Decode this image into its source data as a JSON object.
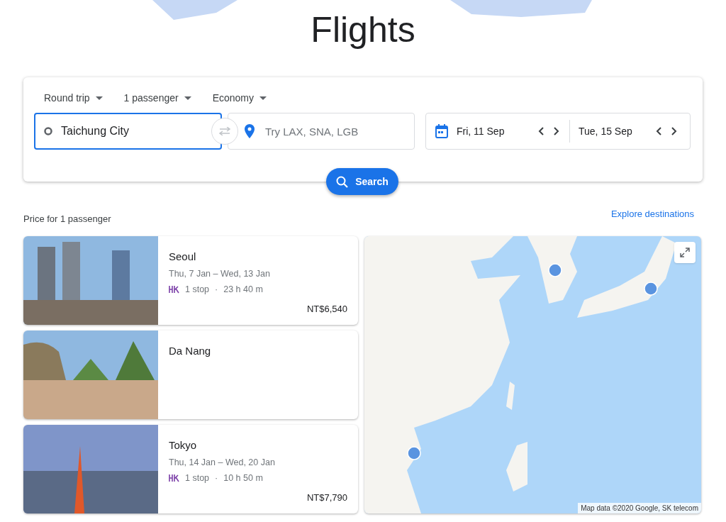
{
  "title": "Flights",
  "search": {
    "options": [
      {
        "label": "Round trip"
      },
      {
        "label": "1 passenger"
      },
      {
        "label": "Economy"
      }
    ],
    "origin": {
      "value": "Taichung City",
      "focused": true
    },
    "destination": {
      "placeholder": "Try LAX, SNA, LGB"
    },
    "depart": "Fri, 11 Sep",
    "return": "Tue, 15 Sep",
    "button": "Search"
  },
  "price_note": "Price for 1 passenger",
  "explore_link": "Explore destinations",
  "results": [
    {
      "city": "Seoul",
      "dates": "Thu, 7 Jan – Wed, 13 Jan",
      "stops": "1 stop",
      "duration": "23 h 40 m",
      "price": "NT$6,540",
      "separator": "·"
    },
    {
      "city": "Da Nang"
    },
    {
      "city": "Tokyo",
      "dates": "Thu, 14 Jan – Wed, 20 Jan",
      "stops": "1 stop",
      "duration": "10 h 50 m",
      "price": "NT$7,790",
      "separator": "·"
    }
  ],
  "map": {
    "attribution": "Map data ©2020 Google, SK telecom"
  }
}
